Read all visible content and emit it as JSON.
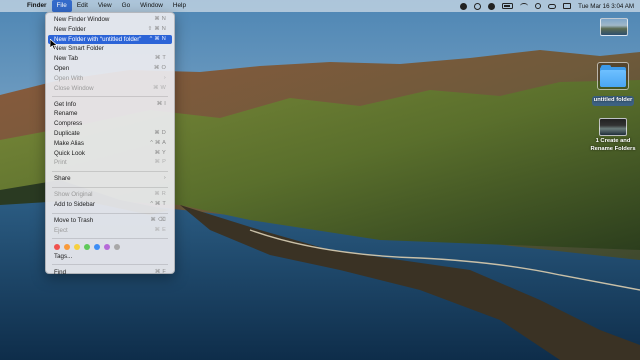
{
  "menubar": {
    "apple": "",
    "items": [
      "Finder",
      "File",
      "Edit",
      "View",
      "Go",
      "Window",
      "Help"
    ],
    "active_index": 1,
    "status": {
      "datetime": "Tue Mar 16  3:04 AM"
    }
  },
  "file_menu": {
    "groups": [
      [
        {
          "label": "New Finder Window",
          "shortcut": "⌘ N",
          "state": "normal"
        },
        {
          "label": "New Folder",
          "shortcut": "⇧ ⌘ N",
          "state": "normal"
        },
        {
          "label": "New Folder with “untitled folder”",
          "shortcut": "^ ⌘ N",
          "state": "highlight"
        },
        {
          "label": "New Smart Folder",
          "shortcut": "",
          "state": "normal"
        },
        {
          "label": "New Tab",
          "shortcut": "⌘ T",
          "state": "normal"
        },
        {
          "label": "Open",
          "shortcut": "⌘ O",
          "state": "normal"
        },
        {
          "label": "Open With",
          "shortcut": "›",
          "state": "disabled"
        },
        {
          "label": "Close Window",
          "shortcut": "⌘ W",
          "state": "disabled"
        }
      ],
      [
        {
          "label": "Get Info",
          "shortcut": "⌘ I",
          "state": "normal"
        },
        {
          "label": "Rename",
          "shortcut": "",
          "state": "normal"
        },
        {
          "label": "Compress",
          "shortcut": "",
          "state": "normal"
        },
        {
          "label": "Duplicate",
          "shortcut": "⌘ D",
          "state": "normal"
        },
        {
          "label": "Make Alias",
          "shortcut": "^ ⌘ A",
          "state": "normal"
        },
        {
          "label": "Quick Look",
          "shortcut": "⌘ Y",
          "state": "normal"
        },
        {
          "label": "Print",
          "shortcut": "⌘ P",
          "state": "disabled"
        }
      ],
      [
        {
          "label": "Share",
          "shortcut": "›",
          "state": "normal"
        }
      ],
      [
        {
          "label": "Show Original",
          "shortcut": "⌘ R",
          "state": "disabled"
        },
        {
          "label": "Add to Sidebar",
          "shortcut": "^ ⌘ T",
          "state": "normal"
        }
      ],
      [
        {
          "label": "Move to Trash",
          "shortcut": "⌘ ⌫",
          "state": "normal"
        },
        {
          "label": "Eject",
          "shortcut": "⌘ E",
          "state": "disabled"
        }
      ]
    ],
    "tag_colors": [
      "#f0524f",
      "#f89a3a",
      "#f6cf3e",
      "#5fc95a",
      "#3d8df5",
      "#b66ad8",
      "#a8a8a8"
    ],
    "tags_label": "Tags...",
    "find": {
      "label": "Find",
      "shortcut": "⌘ F"
    }
  },
  "desktop": {
    "items": [
      {
        "label": "",
        "kind": "screenshot"
      },
      {
        "label": "untitled folder",
        "kind": "folder",
        "selected": true
      },
      {
        "label": "1 Create and\nRename Folders",
        "kind": "screenshot-dark"
      }
    ]
  }
}
